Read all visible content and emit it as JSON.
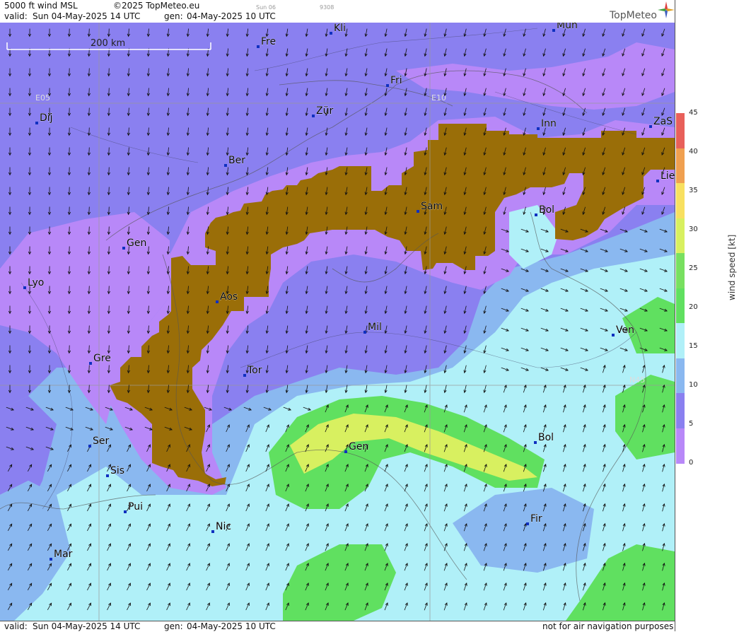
{
  "header": {
    "product": "5000 ft wind MSL",
    "copyright": "©2025 TopMeteo.eu",
    "valid_label": "valid:",
    "valid": "Sun  04-May-2025  14 UTC",
    "gen_label": "gen:",
    "gen": "04-May-2025 10 UTC",
    "faint_day": "Sun 06",
    "faint_code": "9308",
    "logo": "TopMeteo"
  },
  "scale": {
    "label": "200 km"
  },
  "grid_labels": {
    "e05": "E05",
    "e10": "E10",
    "n45": "N45"
  },
  "cities": [
    {
      "name": "Kli"
    },
    {
      "name": "Mün"
    },
    {
      "name": "Fre"
    },
    {
      "name": "Fri"
    },
    {
      "name": "Dij"
    },
    {
      "name": "Zür"
    },
    {
      "name": "Inn"
    },
    {
      "name": "ZaS"
    },
    {
      "name": "Ber"
    },
    {
      "name": "Lie"
    },
    {
      "name": "Sam"
    },
    {
      "name": "Bol"
    },
    {
      "name": "Gen"
    },
    {
      "name": "Lyo"
    },
    {
      "name": "Aos"
    },
    {
      "name": "Mil"
    },
    {
      "name": "Ven"
    },
    {
      "name": "Gre"
    },
    {
      "name": "Tor"
    },
    {
      "name": "Ser"
    },
    {
      "name": "Gen"
    },
    {
      "name": "Bol"
    },
    {
      "name": "Sis"
    },
    {
      "name": "Pui"
    },
    {
      "name": "Nic"
    },
    {
      "name": "Fir"
    },
    {
      "name": "Mar"
    }
  ],
  "legend": {
    "title": "wind speed [kt]",
    "ticks": [
      "45",
      "40",
      "35",
      "30",
      "25",
      "20",
      "15",
      "10",
      "5",
      "0"
    ],
    "colors": [
      "#e8605a",
      "#f0a050",
      "#f8e060",
      "#d8f060",
      "#78e060",
      "#60e060",
      "#b0f0f8",
      "#8ab8f0",
      "#8a80f0",
      "#b888f8"
    ]
  },
  "footer": {
    "valid_label": "valid:",
    "valid": "Sun  04-May-2025  14 UTC",
    "gen_label": "gen:",
    "gen": "04-May-2025 10 UTC",
    "disclaimer": "not for air navigation purposes"
  },
  "colors": {
    "terrain": "#9a6e08",
    "lt5": "#b888f8",
    "b5_10": "#8a80f0",
    "b10_15": "#8ab8f0",
    "b15_20": "#b0f0f8",
    "b20_25": "#60e060",
    "b25_30": "#d8f060"
  }
}
